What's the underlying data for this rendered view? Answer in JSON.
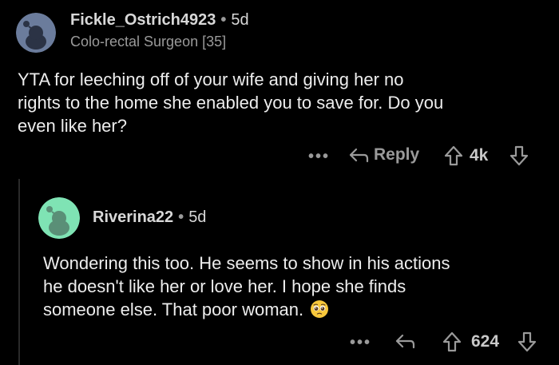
{
  "comments": [
    {
      "username": "Fickle_Ostrich4923",
      "separator": "•",
      "age": "5d",
      "flair": "Colo-rectal Surgeon [35]",
      "body_lines": [
        "YTA for leeching off of your wife and giving her no",
        "rights to the home she enabled you to save for. Do you",
        "even like her?"
      ],
      "more_label": "•••",
      "reply_label": "Reply",
      "vote_count": "4k",
      "avatar_color": "#6b7c9c"
    },
    {
      "username": "Riverina22",
      "separator": "•",
      "age": "5d",
      "body_lines": [
        "Wondering this too. He seems to show in his actions",
        "he doesn't like her or love her. I hope she finds",
        "someone else. That poor woman."
      ],
      "emoji": "pleading-face",
      "more_label": "•••",
      "vote_count": "624",
      "avatar_color": "#7fe3b4"
    }
  ]
}
